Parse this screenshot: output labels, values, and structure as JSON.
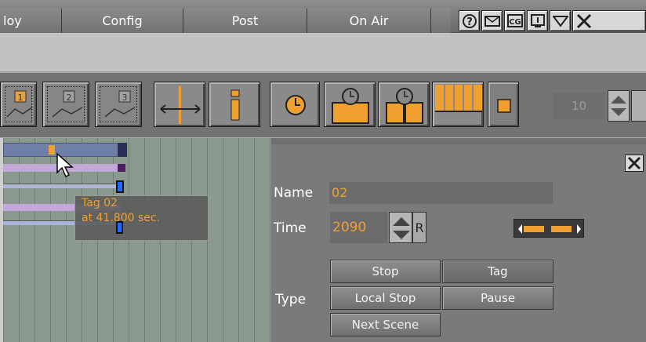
{
  "menubar": {
    "items": [
      {
        "label": "loy"
      },
      {
        "label": "Config"
      },
      {
        "label": "Post"
      },
      {
        "label": "On Air"
      }
    ],
    "window_buttons": [
      "help-icon",
      "mail-icon",
      "cg-icon",
      "info-icon",
      "dropdown-icon",
      "close-icon"
    ]
  },
  "toolbar": {
    "layer_buttons": [
      "1",
      "2",
      "3"
    ],
    "number_value": "10"
  },
  "tooltip": {
    "line1": "Tag 02",
    "line2": "at 41.800 sec."
  },
  "panel": {
    "name_label": "Name",
    "name_value": "02",
    "time_label": "Time",
    "time_value": "2090",
    "reset_label": "R",
    "type_label": "Type",
    "types": [
      {
        "label": "Stop",
        "selected": false
      },
      {
        "label": "Tag",
        "selected": true
      },
      {
        "label": "Local Stop",
        "selected": false
      },
      {
        "label": "Pause",
        "selected": false
      },
      {
        "label": "Next Scene",
        "selected": false
      }
    ]
  },
  "colors": {
    "accent": "#f0a030",
    "panel": "#7a7a7a",
    "timeline": "#8a9a8e"
  }
}
